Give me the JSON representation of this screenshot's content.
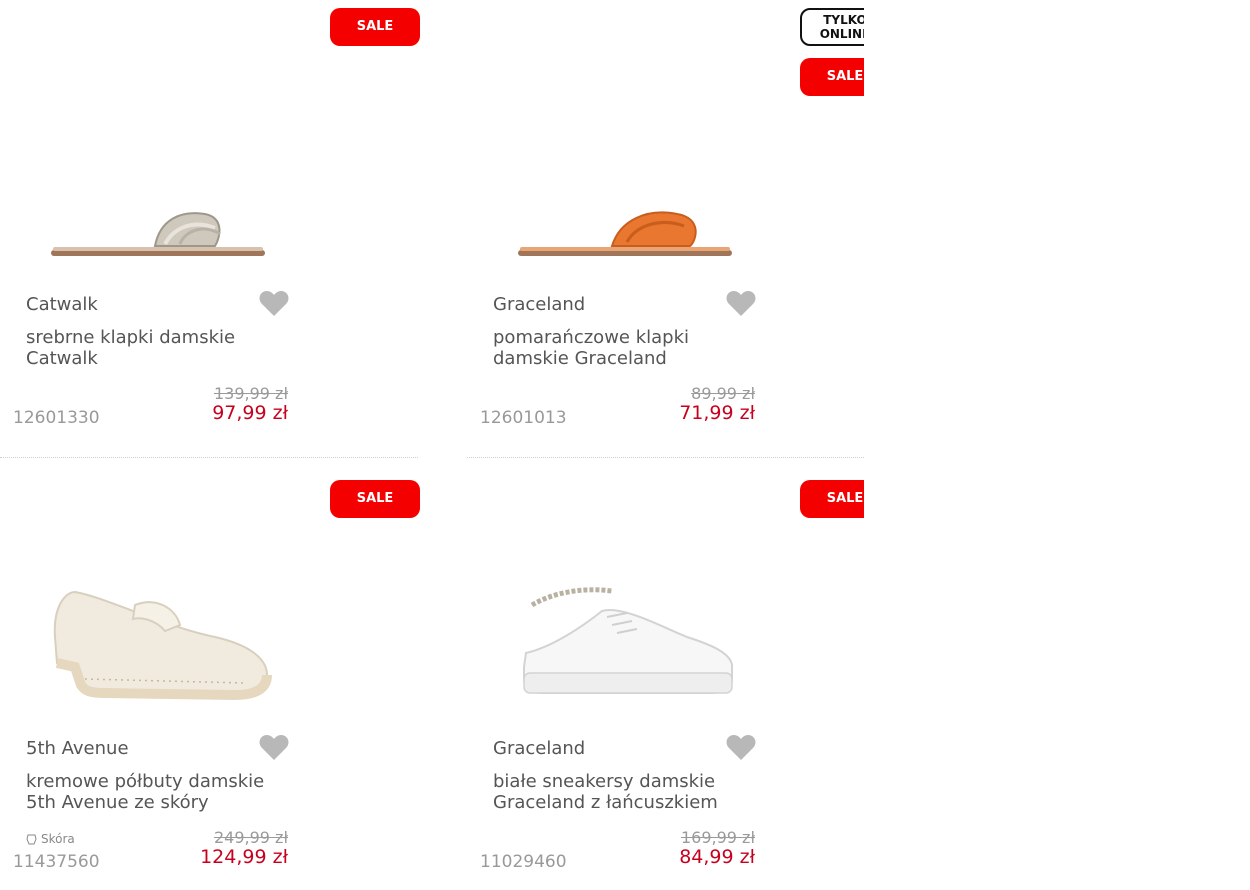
{
  "colors": {
    "sale": "#f40000",
    "price_new": "#c8001e"
  },
  "products": [
    {
      "badges": [
        "SALE"
      ],
      "brand": "Catwalk",
      "name": "srebrne klapki damskie Catwalk",
      "old_price": "139,99",
      "currency": "zł",
      "new_price": "97,99 zł",
      "sku": "12601330",
      "image": "silver-slide-sandal",
      "favorite_icon": "heart-icon"
    },
    {
      "badges": [
        "TYLKO ONLINE",
        "SALE"
      ],
      "brand": "Graceland",
      "name": "pomarańczowe klapki damskie Graceland",
      "old_price": "89,99",
      "currency": "zł",
      "new_price": "71,99 zł",
      "sku": "12601013",
      "image": "orange-slide-sandal",
      "favorite_icon": "heart-icon"
    },
    {
      "badges": [
        "SALE"
      ],
      "brand": "5th Avenue",
      "name": "kremowe półbuty damskie 5th Avenue ze skóry",
      "material": "Skóra",
      "old_price": "249,99",
      "currency": "zł",
      "new_price": "124,99 zł",
      "sku": "11437560",
      "image": "cream-loafer",
      "favorite_icon": "heart-icon"
    },
    {
      "badges": [
        "SALE"
      ],
      "brand": "Graceland",
      "name": "białe sneakersy damskie Graceland z łańcuszkiem",
      "old_price": "169,99",
      "currency": "zł",
      "new_price": "84,99 zł",
      "sku": "11029460",
      "image": "white-chain-sneaker",
      "favorite_icon": "heart-icon"
    }
  ]
}
